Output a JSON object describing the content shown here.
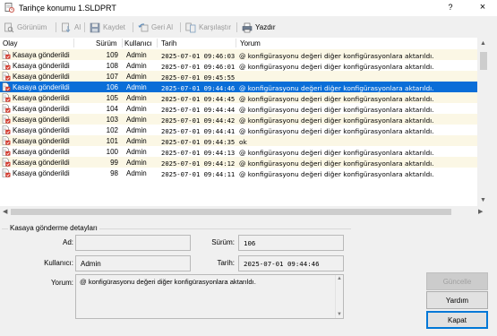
{
  "window": {
    "title": "Tarihçe konumu 1.SLDPRT",
    "help_label": "?",
    "close_label": "×"
  },
  "toolbar": {
    "view_label": "Görünüm",
    "get_label": "Al",
    "save_label": "Kaydet",
    "rollback_label": "Geri Al",
    "compare_label": "Karşılaştır",
    "print_label": "Yazdır"
  },
  "grid": {
    "columns": {
      "event": "Olay",
      "version": "Sürüm",
      "user": "Kullanıcı",
      "date": "Tarih",
      "comment": "Yorum"
    },
    "selected_index": 3,
    "rows": [
      {
        "event": "Kasaya gönderildi",
        "version": "109",
        "user": "Admin",
        "date": "2025-07-01 09:46:03",
        "comment": "@ konfigürasyonu değeri diğer konfigürasyonlara aktarıldı."
      },
      {
        "event": "Kasaya gönderildi",
        "version": "108",
        "user": "Admin",
        "date": "2025-07-01 09:46:01",
        "comment": "@ konfigürasyonu değeri diğer konfigürasyonlara aktarıldı."
      },
      {
        "event": "Kasaya gönderildi",
        "version": "107",
        "user": "Admin",
        "date": "2025-07-01 09:45:55",
        "comment": ""
      },
      {
        "event": "Kasaya gönderildi",
        "version": "106",
        "user": "Admin",
        "date": "2025-07-01 09:44:46",
        "comment": "@ konfigürasyonu değeri diğer konfigürasyonlara aktarıldı."
      },
      {
        "event": "Kasaya gönderildi",
        "version": "105",
        "user": "Admin",
        "date": "2025-07-01 09:44:45",
        "comment": "@ konfigürasyonu değeri diğer konfigürasyonlara aktarıldı."
      },
      {
        "event": "Kasaya gönderildi",
        "version": "104",
        "user": "Admin",
        "date": "2025-07-01 09:44:44",
        "comment": "@ konfigürasyonu değeri diğer konfigürasyonlara aktarıldı."
      },
      {
        "event": "Kasaya gönderildi",
        "version": "103",
        "user": "Admin",
        "date": "2025-07-01 09:44:42",
        "comment": "@ konfigürasyonu değeri diğer konfigürasyonlara aktarıldı."
      },
      {
        "event": "Kasaya gönderildi",
        "version": "102",
        "user": "Admin",
        "date": "2025-07-01 09:44:41",
        "comment": "@ konfigürasyonu değeri diğer konfigürasyonlara aktarıldı."
      },
      {
        "event": "Kasaya gönderildi",
        "version": "101",
        "user": "Admin",
        "date": "2025-07-01 09:44:35",
        "comment": "ok"
      },
      {
        "event": "Kasaya gönderildi",
        "version": "100",
        "user": "Admin",
        "date": "2025-07-01 09:44:13",
        "comment": "@ konfigürasyonu değeri diğer konfigürasyonlara aktarıldı."
      },
      {
        "event": "Kasaya gönderildi",
        "version": "99",
        "user": "Admin",
        "date": "2025-07-01 09:44:12",
        "comment": "@ konfigürasyonu değeri diğer konfigürasyonlara aktarıldı."
      },
      {
        "event": "Kasaya gönderildi",
        "version": "98",
        "user": "Admin",
        "date": "2025-07-01 09:44:11",
        "comment": "@ konfigürasyonu değeri diğer konfigürasyonlara aktarıldı."
      }
    ]
  },
  "details": {
    "group_title": "Kasaya gönderme detayları",
    "name_label": "Ad:",
    "name_value": "",
    "version_label": "Sürüm:",
    "version_value": "106",
    "user_label": "Kullanıcı:",
    "user_value": "Admin",
    "date_label": "Tarih:",
    "date_value": "2025-07-01 09:44:46",
    "comment_label": "Yorum:",
    "comment_value": "@ konfigürasyonu değeri diğer konfigürasyonlara aktarıldı."
  },
  "buttons": {
    "update_label": "Güncelle",
    "help_label": "Yardım",
    "close_label": "Kapat"
  },
  "colors": {
    "selection": "#0a6ed8",
    "row_alt": "#fbf7e5",
    "default_button_border": "#0078d7"
  },
  "icons": {
    "row_icon": "checked-in-document-icon"
  }
}
